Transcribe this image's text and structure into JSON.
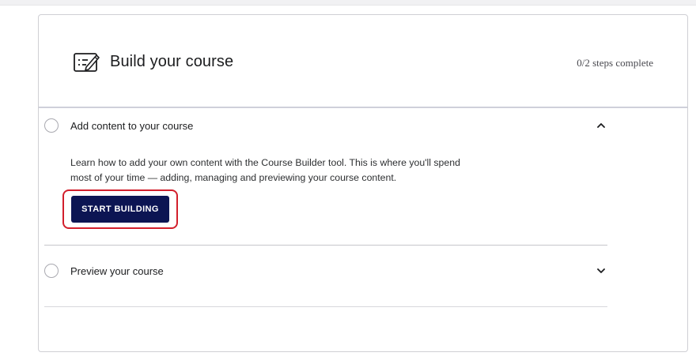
{
  "card": {
    "title": "Build your course",
    "status": "0/2 steps complete",
    "icon": "course-builder-icon"
  },
  "steps": [
    {
      "title": "Add content to your course",
      "expanded": true,
      "toggle_icon": "chevron-up-icon",
      "description": "Learn how to add your own content with the Course Builder tool. This is where you'll spend most of your time — adding, managing and previewing your course content.",
      "button_label": "START BUILDING"
    },
    {
      "title": "Preview your course",
      "expanded": false,
      "toggle_icon": "chevron-down-icon"
    }
  ],
  "colors": {
    "primary_button": "#0c1553",
    "highlight_outline": "#d21f2c"
  }
}
